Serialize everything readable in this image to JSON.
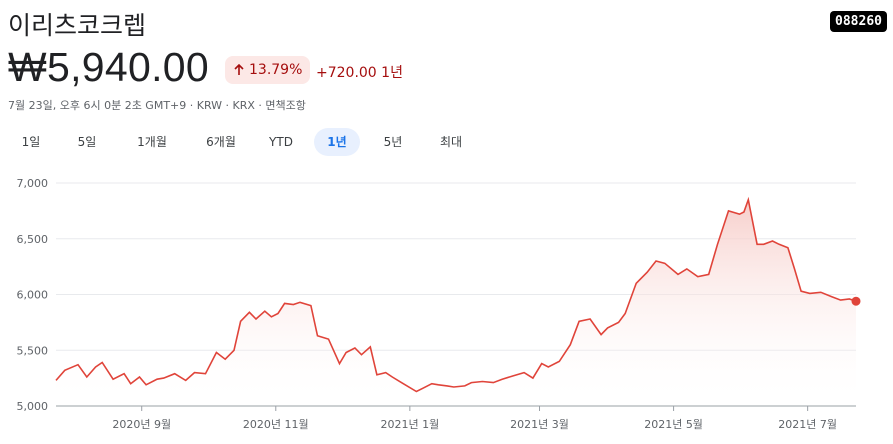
{
  "header": {
    "title": "이리츠코크렙",
    "ticker": "088260",
    "price": "₩5,940.00",
    "change_pct": "13.79%",
    "change_abs": "+720.00 1년",
    "meta": "7월 23일, 오후 6시 0분 2초 GMT+9 · KRW · KRX · 면책조항"
  },
  "tabs": [
    {
      "label": "1일"
    },
    {
      "label": "5일"
    },
    {
      "label": "1개월"
    },
    {
      "label": "6개월"
    },
    {
      "label": "YTD"
    },
    {
      "label": "1년",
      "active": true
    },
    {
      "label": "5년"
    },
    {
      "label": "최대"
    }
  ],
  "colors": {
    "line": "#e0443a",
    "fill_top": "#f6c9c5",
    "badge_bg": "#fce8e6",
    "badge_fg": "#a50e0e",
    "grid": "#e8eaed"
  },
  "chart_data": {
    "type": "area",
    "ylim": [
      5000,
      7000
    ],
    "yticks": [
      "7,000",
      "6,500",
      "6,000",
      "5,500",
      "5,000"
    ],
    "ytick_values": [
      7000,
      6500,
      6000,
      5500,
      5000
    ],
    "xtick_labels": [
      "2020년 9월",
      "2020년 11월",
      "2021년 1월",
      "2021년 3월",
      "2021년 5월",
      "2021년 7월"
    ],
    "xtick_dates": [
      "2020-09-01",
      "2020-11-01",
      "2021-01-01",
      "2021-03-01",
      "2021-05-01",
      "2021-07-01"
    ],
    "xlim": [
      "2020-07-24",
      "2021-07-23"
    ],
    "series": [
      {
        "x": [
          "2020-07-24",
          "2020-07-28",
          "2020-08-03",
          "2020-08-07",
          "2020-08-11",
          "2020-08-14",
          "2020-08-19",
          "2020-08-24",
          "2020-08-27",
          "2020-08-31",
          "2020-09-03",
          "2020-09-08",
          "2020-09-11",
          "2020-09-16",
          "2020-09-21",
          "2020-09-25",
          "2020-09-30",
          "2020-10-05",
          "2020-10-09",
          "2020-10-13",
          "2020-10-16",
          "2020-10-20",
          "2020-10-23",
          "2020-10-27",
          "2020-10-30",
          "2020-11-02",
          "2020-11-05",
          "2020-11-09",
          "2020-11-12",
          "2020-11-17",
          "2020-11-20",
          "2020-11-25",
          "2020-11-30",
          "2020-12-03",
          "2020-12-07",
          "2020-12-10",
          "2020-12-14",
          "2020-12-17",
          "2020-12-21",
          "2020-12-24",
          "2020-12-29",
          "2021-01-04",
          "2021-01-07",
          "2021-01-11",
          "2021-01-14",
          "2021-01-18",
          "2021-01-21",
          "2021-01-26",
          "2021-01-29",
          "2021-02-03",
          "2021-02-08",
          "2021-02-12",
          "2021-02-17",
          "2021-02-22",
          "2021-02-26",
          "2021-03-02",
          "2021-03-05",
          "2021-03-10",
          "2021-03-15",
          "2021-03-19",
          "2021-03-24",
          "2021-03-29",
          "2021-04-01",
          "2021-04-06",
          "2021-04-09",
          "2021-04-14",
          "2021-04-19",
          "2021-04-23",
          "2021-04-27",
          "2021-05-03",
          "2021-05-07",
          "2021-05-12",
          "2021-05-17",
          "2021-05-21",
          "2021-05-26",
          "2021-05-31",
          "2021-06-02",
          "2021-06-04",
          "2021-06-08",
          "2021-06-11",
          "2021-06-15",
          "2021-06-18",
          "2021-06-22",
          "2021-06-25",
          "2021-06-28",
          "2021-07-02",
          "2021-07-07",
          "2021-07-12",
          "2021-07-16",
          "2021-07-20",
          "2021-07-23"
        ],
        "values": [
          5230,
          5320,
          5370,
          5260,
          5350,
          5390,
          5240,
          5290,
          5200,
          5260,
          5190,
          5240,
          5250,
          5290,
          5230,
          5300,
          5290,
          5480,
          5420,
          5500,
          5760,
          5840,
          5780,
          5850,
          5800,
          5830,
          5920,
          5910,
          5930,
          5900,
          5630,
          5600,
          5380,
          5480,
          5520,
          5460,
          5530,
          5280,
          5300,
          5260,
          5200,
          5130,
          5160,
          5200,
          5190,
          5180,
          5170,
          5180,
          5210,
          5220,
          5210,
          5240,
          5270,
          5300,
          5250,
          5380,
          5350,
          5400,
          5550,
          5760,
          5780,
          5640,
          5700,
          5750,
          5830,
          6100,
          6200,
          6300,
          6280,
          6180,
          6230,
          6160,
          6180,
          6450,
          6750,
          6720,
          6740,
          6850,
          6450,
          6450,
          6480,
          6450,
          6420,
          6230,
          6030,
          6010,
          6020,
          5980,
          5950,
          5960,
          5940
        ]
      }
    ]
  }
}
